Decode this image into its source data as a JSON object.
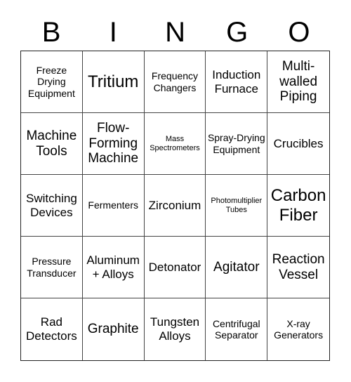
{
  "header": [
    "B",
    "I",
    "N",
    "G",
    "O"
  ],
  "cells": [
    {
      "text": "Freeze Drying Equipment",
      "size": "s-sm"
    },
    {
      "text": "Tritium",
      "size": "s-xl"
    },
    {
      "text": "Frequency Changers",
      "size": "s-sm"
    },
    {
      "text": "Induction Furnace",
      "size": "s-md"
    },
    {
      "text": "Multi-walled Piping",
      "size": "s-lg"
    },
    {
      "text": "Machine Tools",
      "size": "s-lg"
    },
    {
      "text": "Flow-Forming Machine",
      "size": "s-lg"
    },
    {
      "text": "Mass Spectrometers",
      "size": "s-xs"
    },
    {
      "text": "Spray-Drying Equipment",
      "size": "s-sm"
    },
    {
      "text": "Crucibles",
      "size": "s-md"
    },
    {
      "text": "Switching Devices",
      "size": "s-md"
    },
    {
      "text": "Fermenters",
      "size": "s-sm"
    },
    {
      "text": "Zirconium",
      "size": "s-md"
    },
    {
      "text": "Photomultiplier Tubes",
      "size": "s-xs"
    },
    {
      "text": "Carbon Fiber",
      "size": "s-xl"
    },
    {
      "text": "Pressure Transducer",
      "size": "s-sm"
    },
    {
      "text": "Aluminum + Alloys",
      "size": "s-md"
    },
    {
      "text": "Detonator",
      "size": "s-md"
    },
    {
      "text": "Agitator",
      "size": "s-lg"
    },
    {
      "text": "Reaction Vessel",
      "size": "s-lg"
    },
    {
      "text": "Rad Detectors",
      "size": "s-md"
    },
    {
      "text": "Graphite",
      "size": "s-lg"
    },
    {
      "text": "Tungsten Alloys",
      "size": "s-md"
    },
    {
      "text": "Centrifugal Separator",
      "size": "s-sm"
    },
    {
      "text": "X-ray Generators",
      "size": "s-sm"
    }
  ]
}
